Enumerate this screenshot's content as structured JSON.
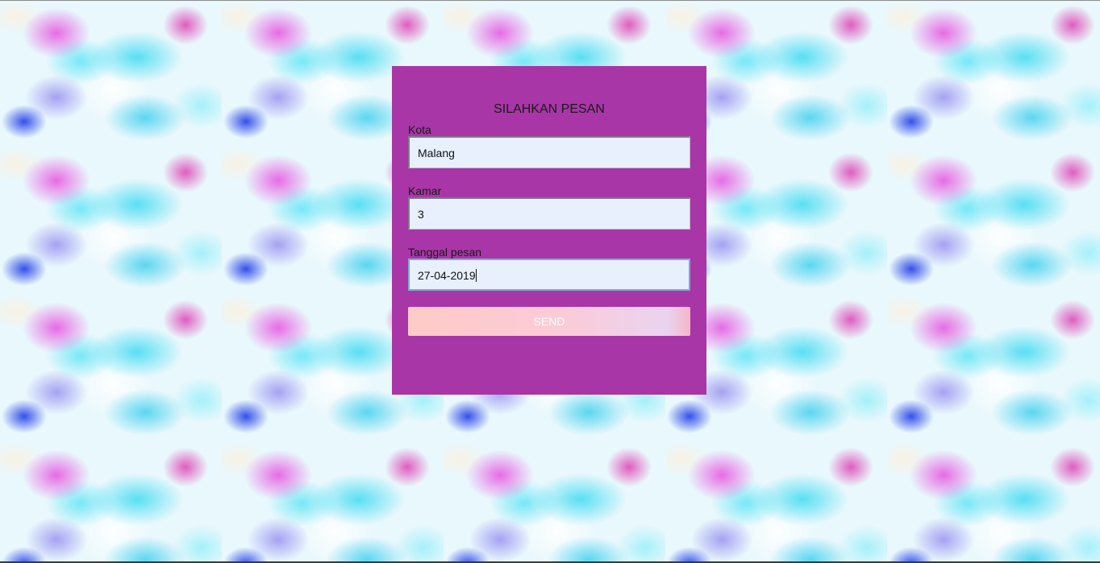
{
  "form": {
    "title": "SILAHKAN PESAN",
    "fields": [
      {
        "label": "Kota",
        "value": "Malang"
      },
      {
        "label": "Kamar",
        "value": "3"
      },
      {
        "label": "Tanggal pesan",
        "value": "27-04-2019"
      }
    ],
    "submit_label": "SEND"
  },
  "colors": {
    "card_background": "#a936a6",
    "input_background": "#e8f0fe",
    "button_gradient_start": "#fecbc7",
    "button_gradient_end": "#ead3f0",
    "button_text": "#ffffff"
  }
}
